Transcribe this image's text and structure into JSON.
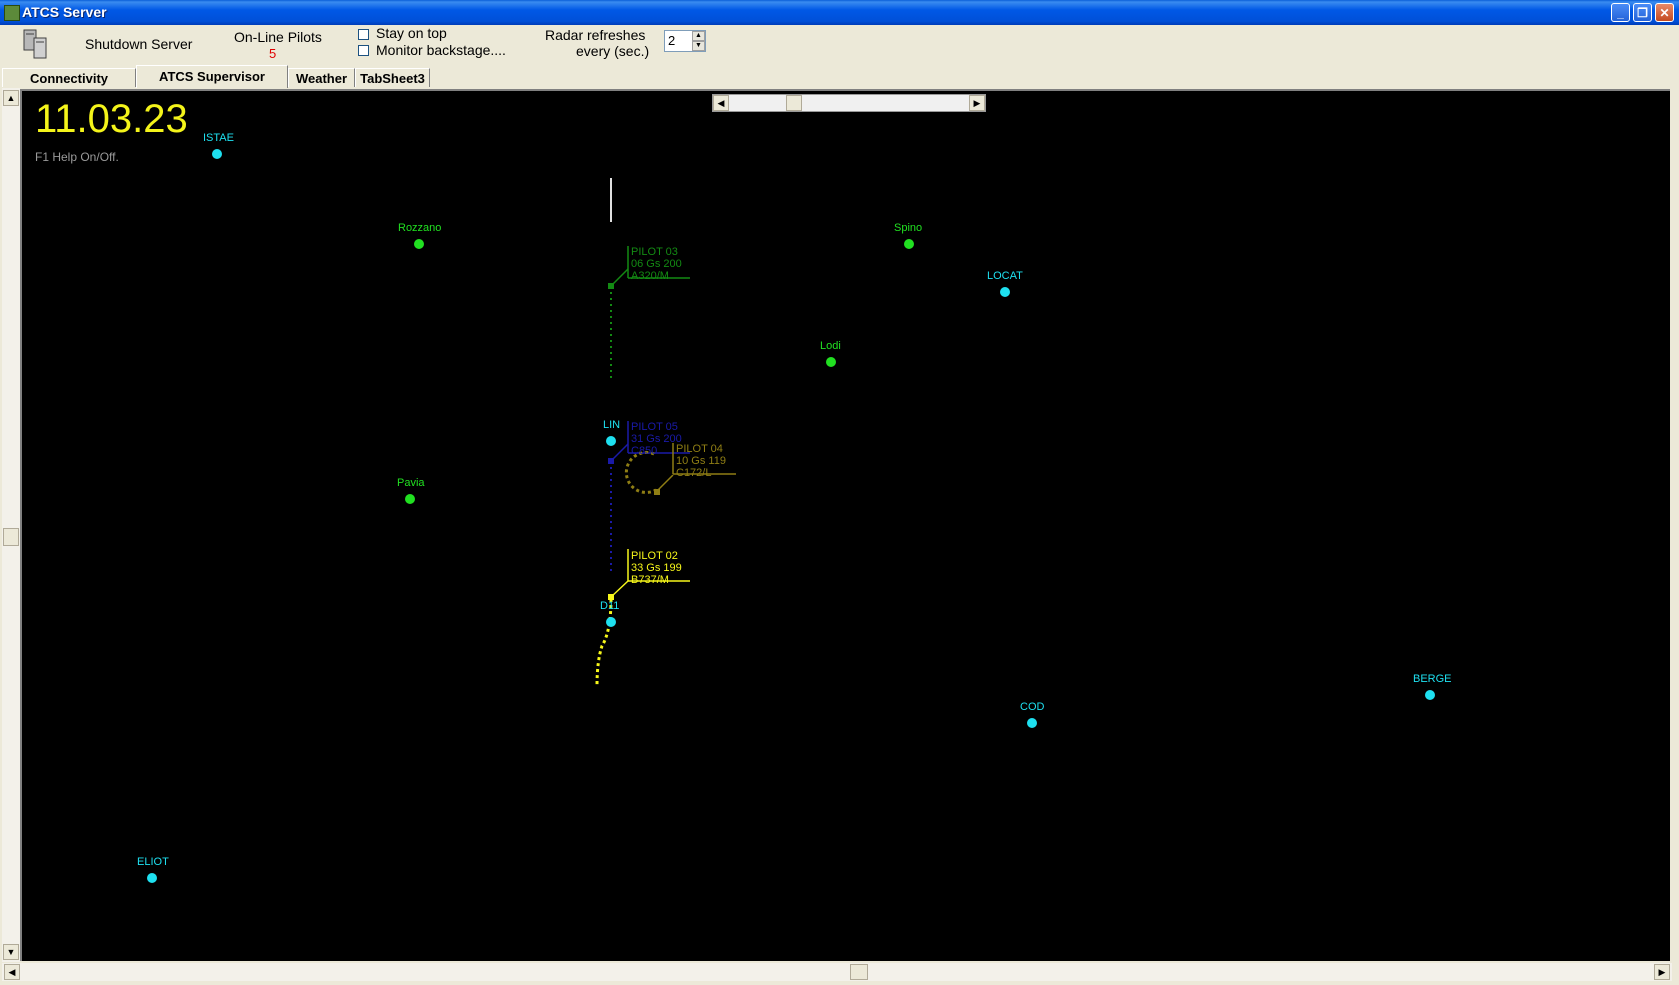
{
  "window": {
    "title": "ATCS Server",
    "minimize": "0",
    "maximize": "1",
    "close": "r"
  },
  "toolbar": {
    "shutdown_label": "Shutdown Server",
    "online_pilots_label": "On-Line Pilots",
    "online_pilots_count": "5",
    "stay_on_top_label": "Stay on top",
    "monitor_backstage_label": "Monitor backstage....",
    "radar_refresh_line1": "Radar refreshes",
    "radar_refresh_line2": "every (sec.)",
    "radar_refresh_value": "2"
  },
  "tabs": [
    "Connectivity",
    "ATCS Supervisor",
    "Weather",
    "TabSheet3"
  ],
  "active_tab": "ATCS Supervisor",
  "radar": {
    "clock": "11.03.23",
    "help_hint": "F1 Help On/Off.",
    "waypoints": [
      {
        "name": "ISTAE",
        "kind": "fix"
      },
      {
        "name": "Rozzano",
        "kind": "town"
      },
      {
        "name": "Spino",
        "kind": "town"
      },
      {
        "name": "LOCAT",
        "kind": "fix"
      },
      {
        "name": "Lodi",
        "kind": "town"
      },
      {
        "name": "LIN",
        "kind": "fix"
      },
      {
        "name": "Pavia",
        "kind": "town"
      },
      {
        "name": "D11",
        "kind": "fix"
      },
      {
        "name": "BERGE",
        "kind": "fix"
      },
      {
        "name": "COD",
        "kind": "fix"
      },
      {
        "name": "ELIOT",
        "kind": "fix"
      }
    ],
    "pilots": [
      {
        "callsign": "PILOT 03",
        "line2": "06  Gs 200",
        "line3": "A320/M",
        "color": "#138a13"
      },
      {
        "callsign": "PILOT 05",
        "line2": "31  Gs 200",
        "line3": "C850",
        "color": "#1a1aa8"
      },
      {
        "callsign": "PILOT 04",
        "line2": "10  Gs 119",
        "line3": "C172/L",
        "color": "#8f7e14"
      },
      {
        "callsign": "PILOT 02",
        "line2": "33  Gs 199",
        "line3": "B737/M",
        "color": "#f7f71a"
      }
    ],
    "colors": {
      "fix": "#1ee0f0",
      "town": "#21e021",
      "clock": "#f4f41a",
      "hint": "#9a9a9a"
    }
  }
}
